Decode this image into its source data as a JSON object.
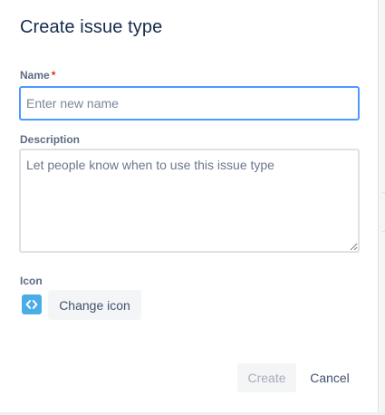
{
  "dialog": {
    "title": "Create issue type"
  },
  "form": {
    "name": {
      "label": "Name",
      "required_marker": "*",
      "value": "",
      "placeholder": "Enter new name"
    },
    "description": {
      "label": "Description",
      "value": "",
      "placeholder": "Let people know when to use this issue type"
    },
    "icon": {
      "label": "Icon",
      "icon_name": "code-brackets-icon",
      "icon_color": "#4BADE8",
      "change_label": "Change icon"
    }
  },
  "footer": {
    "create_label": "Create",
    "create_disabled": true,
    "cancel_label": "Cancel"
  },
  "colors": {
    "focus_border": "#4C9AFF",
    "required": "#DE350B",
    "title_text": "#172B4D"
  }
}
